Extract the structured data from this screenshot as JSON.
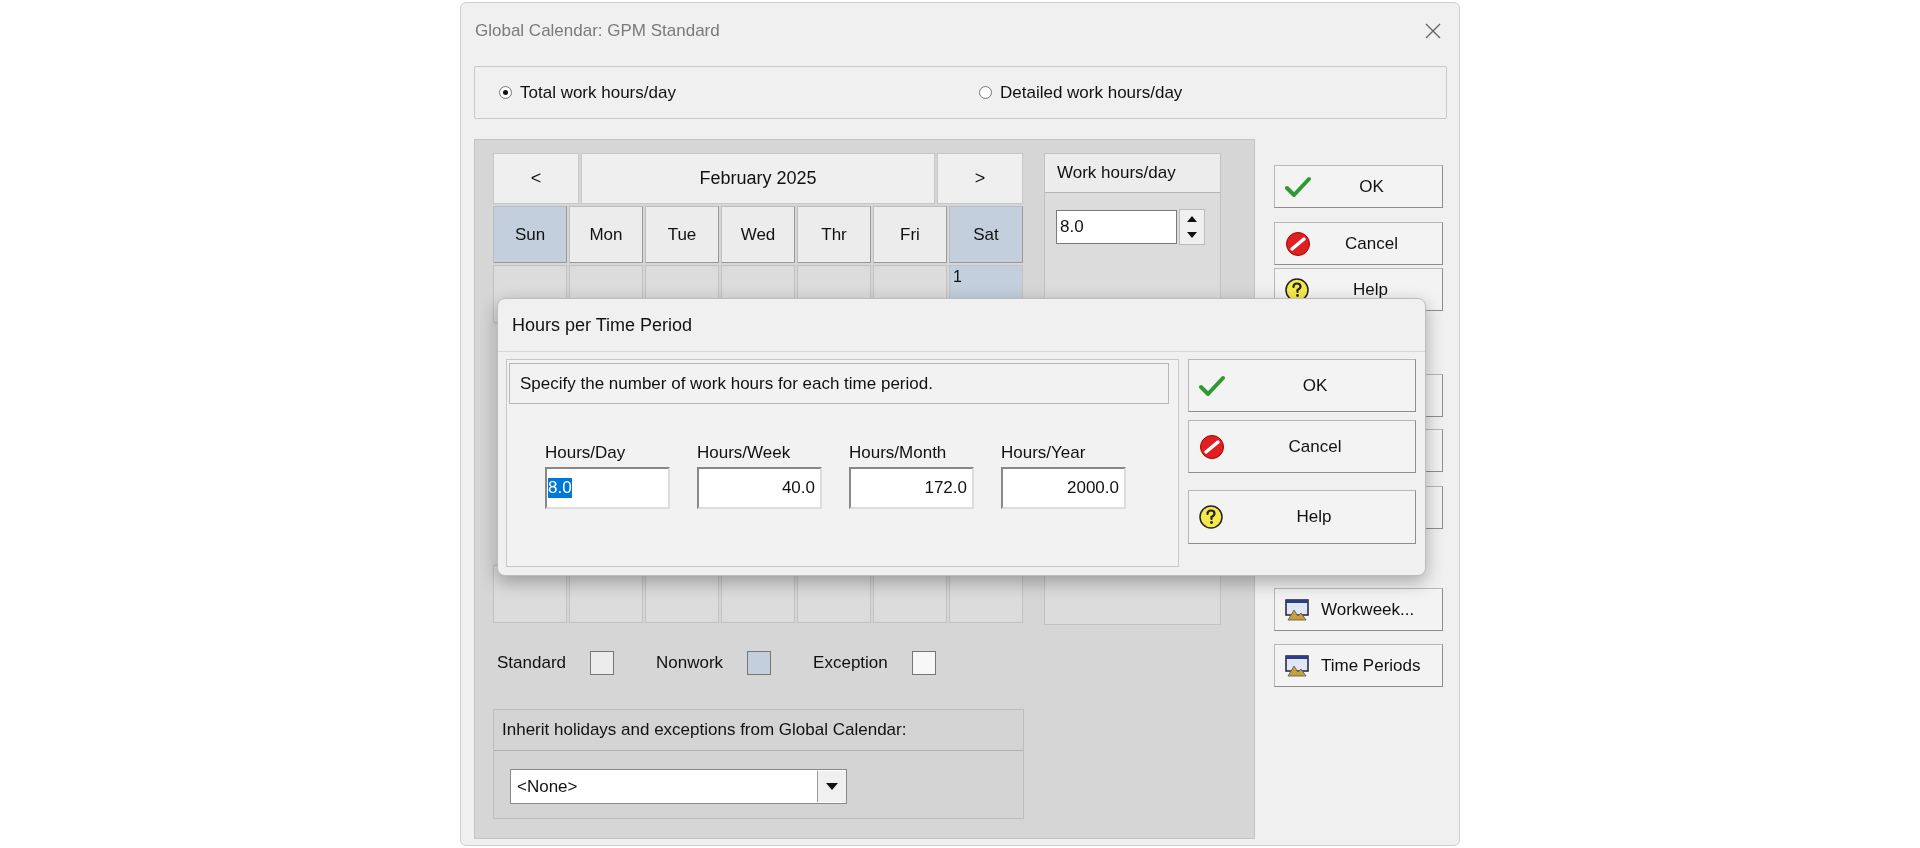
{
  "window": {
    "title": "Global Calendar: GPM Standard"
  },
  "mode_options": [
    {
      "label": "Total work hours/day",
      "selected": true
    },
    {
      "label": "Detailed work hours/day",
      "selected": false
    }
  ],
  "calendar": {
    "prev": "<",
    "month": "February 2025",
    "next": ">",
    "weekdays": [
      {
        "label": "Sun",
        "nonwork": true
      },
      {
        "label": "Mon",
        "nonwork": false
      },
      {
        "label": "Tue",
        "nonwork": false
      },
      {
        "label": "Wed",
        "nonwork": false
      },
      {
        "label": "Thr",
        "nonwork": false
      },
      {
        "label": "Fri",
        "nonwork": false
      },
      {
        "label": "Sat",
        "nonwork": true
      }
    ],
    "weeks": [
      [
        {
          "nonwork": false
        },
        {
          "nonwork": false
        },
        {
          "nonwork": false
        },
        {
          "nonwork": false
        },
        {
          "nonwork": false
        },
        {
          "nonwork": false
        },
        {
          "nonwork": true,
          "day": "1"
        }
      ],
      [
        {
          "nonwork": false
        },
        {
          "nonwork": false
        },
        {
          "nonwork": false
        },
        {
          "nonwork": false
        },
        {
          "nonwork": false
        },
        {
          "nonwork": false
        },
        {
          "nonwork": false
        }
      ]
    ]
  },
  "work_hours": {
    "header": "Work hours/day",
    "value": "8.0"
  },
  "legend": [
    {
      "label": "Standard",
      "color": "#ececec"
    },
    {
      "label": "Nonwork",
      "color": "#c3cfdc"
    },
    {
      "label": "Exception",
      "color": "#f7f7f7"
    }
  ],
  "inherit": {
    "label": "Inherit holidays and exceptions from Global Calendar:",
    "value": "<None>"
  },
  "buttons": [
    {
      "kind": "ok",
      "label": "OK"
    },
    {
      "kind": "cancel",
      "label": "Cancel"
    },
    {
      "kind": "help",
      "label": "Help"
    },
    {
      "kind": "blank"
    },
    {
      "kind": "blank"
    },
    {
      "kind": "blank"
    },
    {
      "kind": "window",
      "label": "Workweek..."
    },
    {
      "kind": "window",
      "label": "Time Periods"
    }
  ],
  "popup": {
    "title": "Hours per Time Period",
    "instruction": "Specify the number of work hours for each time period.",
    "fields": [
      {
        "label": "Hours/Day",
        "value": "8.0",
        "selected": true
      },
      {
        "label": "Hours/Week",
        "value": "40.0",
        "selected": false
      },
      {
        "label": "Hours/Month",
        "value": "172.0",
        "selected": false
      },
      {
        "label": "Hours/Year",
        "value": "2000.0",
        "selected": false
      }
    ],
    "buttons": [
      {
        "kind": "ok",
        "label": "OK"
      },
      {
        "kind": "cancel",
        "label": "Cancel"
      },
      {
        "kind": "help",
        "label": "Help"
      }
    ]
  }
}
